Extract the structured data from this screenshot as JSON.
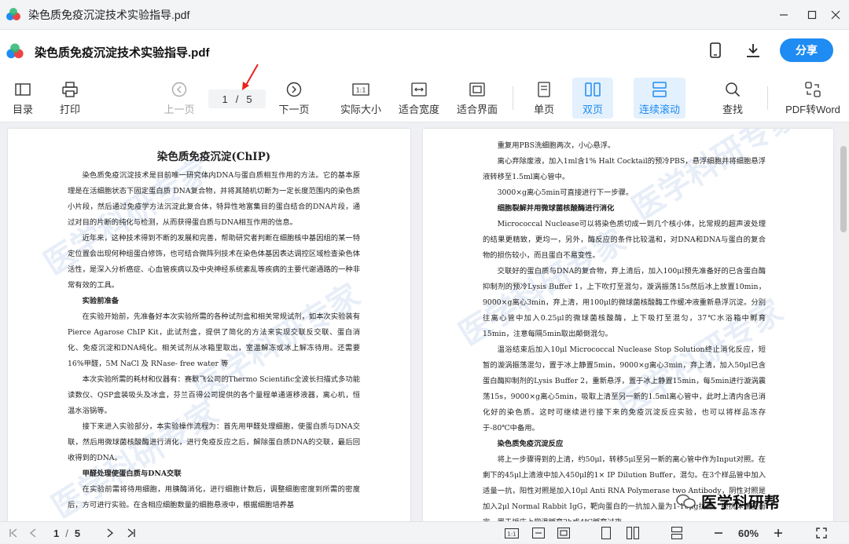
{
  "window": {
    "title": "染色质免疫沉淀技术实验指导.pdf"
  },
  "header": {
    "doc_title": "染色质免疫沉淀技术实验指导.pdf",
    "share_label": "分享"
  },
  "toolbar": {
    "toc": "目录",
    "print": "打印",
    "prev": "上一页",
    "next": "下一页",
    "current_page": "1",
    "sep": "/",
    "total_pages": "5",
    "actual_size": "实际大小",
    "fit_width": "适合宽度",
    "fit_page": "适合界面",
    "single": "单页",
    "double": "双页",
    "continuous": "连续滚动",
    "find": "查找",
    "pdf2word": "PDF转Word"
  },
  "page_left": {
    "title": "染色质免疫沉淀(ChIP)",
    "paragraphs": [
      "染色质免疫沉淀技术是目前唯一研究体内DNA与蛋白质相互作用的方法。它的基本原理是在活细胞状态下固定蛋白质  DNA复合物，并将其随机切断为一定长度范围内的染色质小片段，然后通过免疫学方法沉淀此复合体，特异性地富集目的蛋白结合的DNA片段，通过对目的片断的纯化与检测，从而获得蛋白质与DNA相互作用的信息。",
      "近年来，这种技术得到不断的发展和完善，帮助研究者判断在细胞核中基因组的某一特定位置会出现何种组蛋白修饰，也可结合微阵列技术在染色体基因表达调控区域检查染色体活性，是深入分析癌症、心血管疾病以及中央神经系统紊乱等疾病的主要代谢通路的一种非常有效的工具。"
    ],
    "section1": "实验前准备",
    "paragraphs2": [
      "在实验开始前，先准备好本次实验所需的各种试剂盒和相关常规试剂，如本次实验装有 Pierce Agarose ChIP Kit，此试剂盒，提供了简化的方法来实现交联反交联、蛋白消化、免疫沉淀和DNA纯化。相关试剂从冰箱里取出，室温解冻或冰上解冻待用。还需要16%甲醛，5M NaCl 及 RNase- free water 等",
      "本次实验所需的耗材和仪器有：赛默飞公司的Thermo Scientific全波长扫描式多功能读数仪、QSP盒装吸头及冰盒，芬兰百得公司提供的各个量程单通道移液器，离心机，恒温水浴锅等。",
      "接下来进入实验部分，本实验操作流程为：首先用甲醛处理细胞，使蛋白质与DNA交联，然后用微球菌核酸酶进行消化，进行免疫反应之后，解除蛋白质DNA的交联，最后回收得到的DNA。"
    ],
    "section2": "甲醛处理使蛋白质与DNA交联",
    "paragraphs3": [
      "在实验前需将待用细胞，用胰酶消化，进行细胞计数后，调整细胞密度到所需的密度后，方可进行实验。在含相应细胞数量的细胞悬液中，根据细胞培养基"
    ]
  },
  "page_right": {
    "paragraphs": [
      "重复用PBS洗细胞两次，小心悬浮。",
      "离心弃除废液，加入1ml含1% Halt Cocktail的预冷PBS，悬浮细胞并将细胞悬浮液转移至1.5ml离心管中。",
      "3000×g离心5min可直接进行下一步骤。"
    ],
    "section1": "细胞裂解并用微球菌核酸酶进行消化",
    "paragraphs2": [
      "Micrococcal Nuclease可以将染色质切成一到几个核小体，比常规的超声波处理的结果更精致，更均一，另外，酶反应的条件比较温和，对DNA和DNA与蛋白的复合物的损伤较小，而且蛋白不易变性。",
      "交联好的蛋白质与DNA的复合物，弃上清后，加入100μl预先准备好的已含蛋白酶抑制剂的预冷Lysis Buffer 1，上下吹打至混匀，漩涡振荡15s然后冰上放置10min，9000×g离心3min，弃上清，用100μl的微球菌核酸酶工作缓冲液重新悬浮沉淀。分别往离心管中加入0.25μl的微球菌核酸酶，上下吸打至混匀，37℃水浴箱中孵育15min，注意每隔5min取出颠倒混匀。",
      "温浴结束后加入10μl Micrococcal Nuclease Stop Solution终止消化反应，短暂的漩涡振荡混匀，置于冰上静置5min，9000×g离心3min，弃上清，加入50μl已含蛋白酶抑制剂的Lysis Buffer 2，重新悬浮，置于冰上静置15min，每5min进行漩涡震荡15s，9000×g离心5min，吸取上清至另一新的1.5ml离心管中，此时上清内含已消化好的染色质。这时可继续进行接下来的免疫沉淀反应实验，也可以将样品冻存于-80℃中备用。"
    ],
    "section2": "染色质免疫沉淀反应",
    "paragraphs3": [
      "将上一步骤得到的上清，约50μl，转移5μl至另一新的离心管中作为Input对照。在剩下的45μl上清液中加入450μl的1× IP Dilution Buffer，混匀。在3个样品管中加入适量一抗，阳性对照是加入10μl Anti RNA Polymerase two Antibody，阴性对照是加入2μl Normal Rabbit IgG，靶向蛋白的一抗加入量为1-10μg抗体，视抗体滴度而定，置于摇床上常温孵育2h或4℃孵育过夜。"
    ]
  },
  "watermark": {
    "text": "医学科研专家"
  },
  "brand": {
    "text": "医学科研帮"
  },
  "statusbar": {
    "current_page": "1",
    "sep": "/",
    "total_pages": "5",
    "zoom": "60%"
  }
}
